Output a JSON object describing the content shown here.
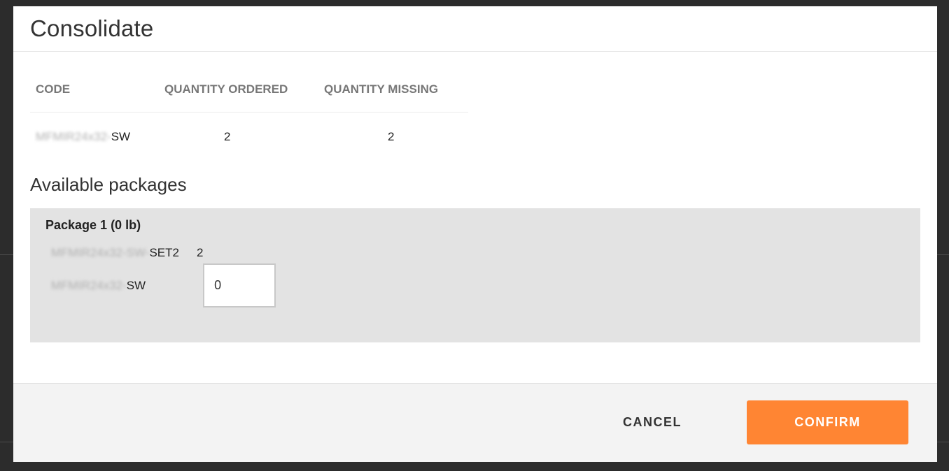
{
  "dialog": {
    "title": "Consolidate"
  },
  "items_table": {
    "headers": {
      "code": "CODE",
      "quantity_ordered": "QUANTITY ORDERED",
      "quantity_missing": "QUANTITY MISSING"
    },
    "rows": [
      {
        "code_prefix": "MFMIR24x32-",
        "code_suffix": "SW",
        "quantity_ordered": "2",
        "quantity_missing": "2"
      }
    ]
  },
  "available_packages": {
    "title": "Available packages",
    "packages": [
      {
        "title": "Package 1 (0 lb)",
        "contents": [
          {
            "code_prefix": "MFMIR24x32-SW-",
            "code_suffix": "SET2",
            "quantity": "2"
          }
        ],
        "input_row": {
          "code_prefix": "MFMIR24x32-",
          "code_suffix": "SW",
          "value": "0"
        }
      }
    ]
  },
  "footer": {
    "cancel_label": "CANCEL",
    "confirm_label": "CONFIRM"
  },
  "colors": {
    "confirm_button": "#ff8533",
    "package_background": "#e3e3e3",
    "footer_background": "#f3f3f3"
  }
}
